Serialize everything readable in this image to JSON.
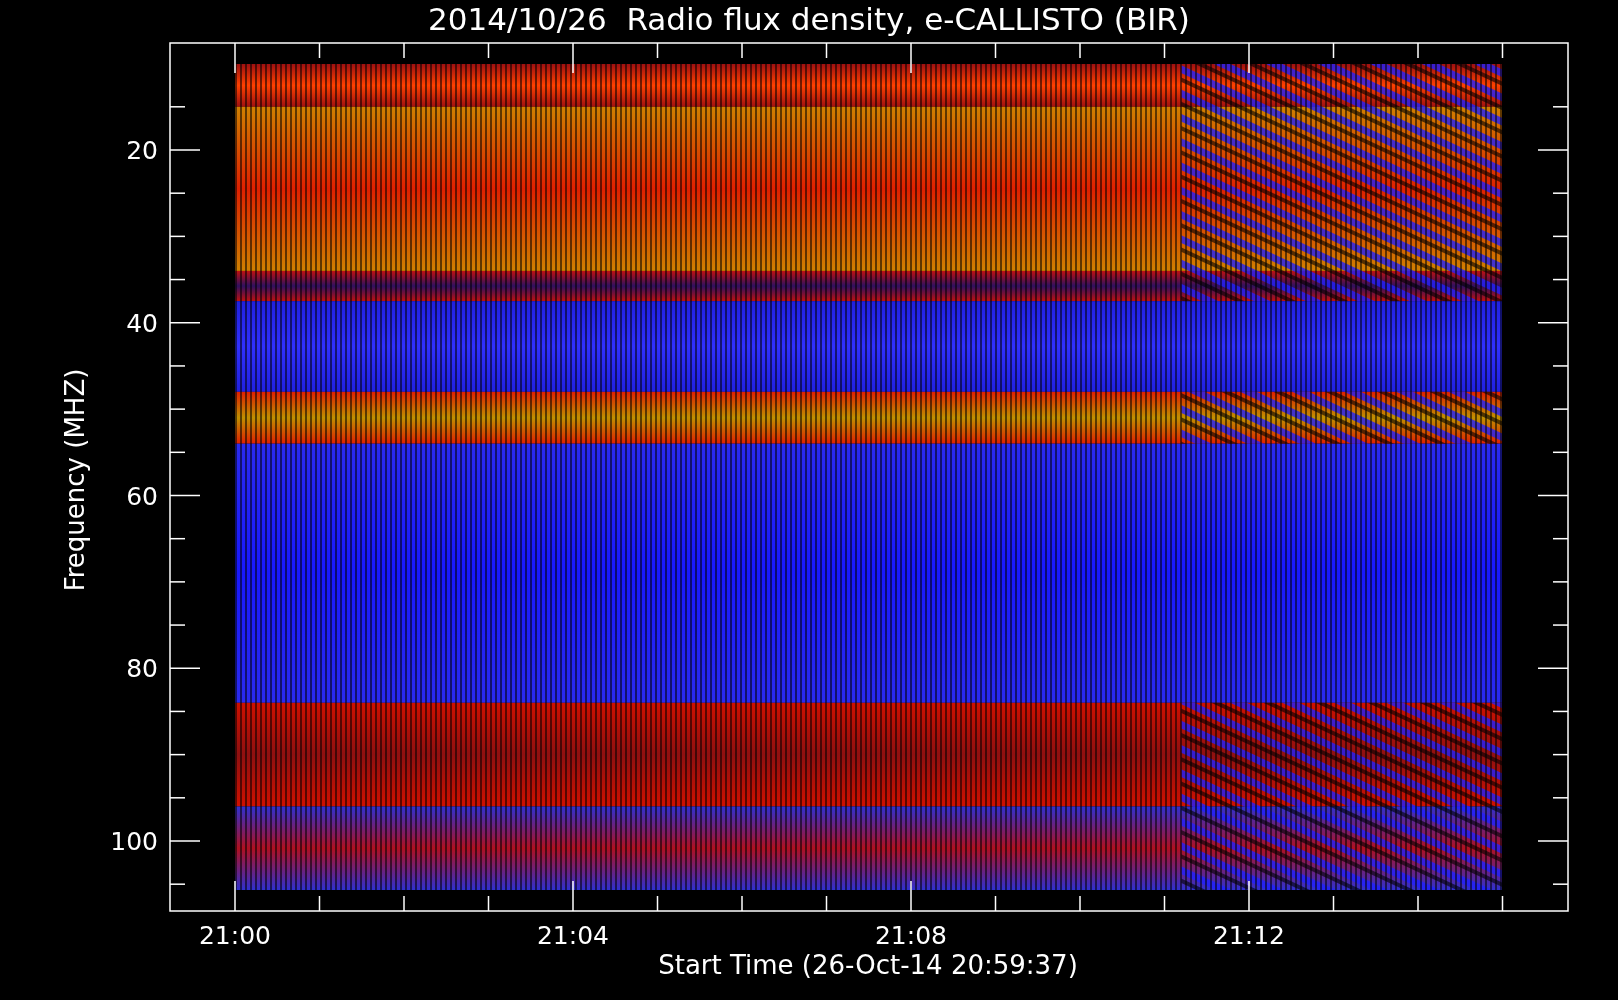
{
  "title": "2014/10/26  Radio flux density, e-CALLISTO (BIR)",
  "ylabel": "Frequency (MHZ)",
  "xlabel": "Start Time (26-Oct-14 20:59:37)",
  "yticks": [
    "20",
    "40",
    "60",
    "80",
    "100"
  ],
  "xticks": [
    "21:00",
    "21:04",
    "21:08",
    "21:12"
  ]
}
